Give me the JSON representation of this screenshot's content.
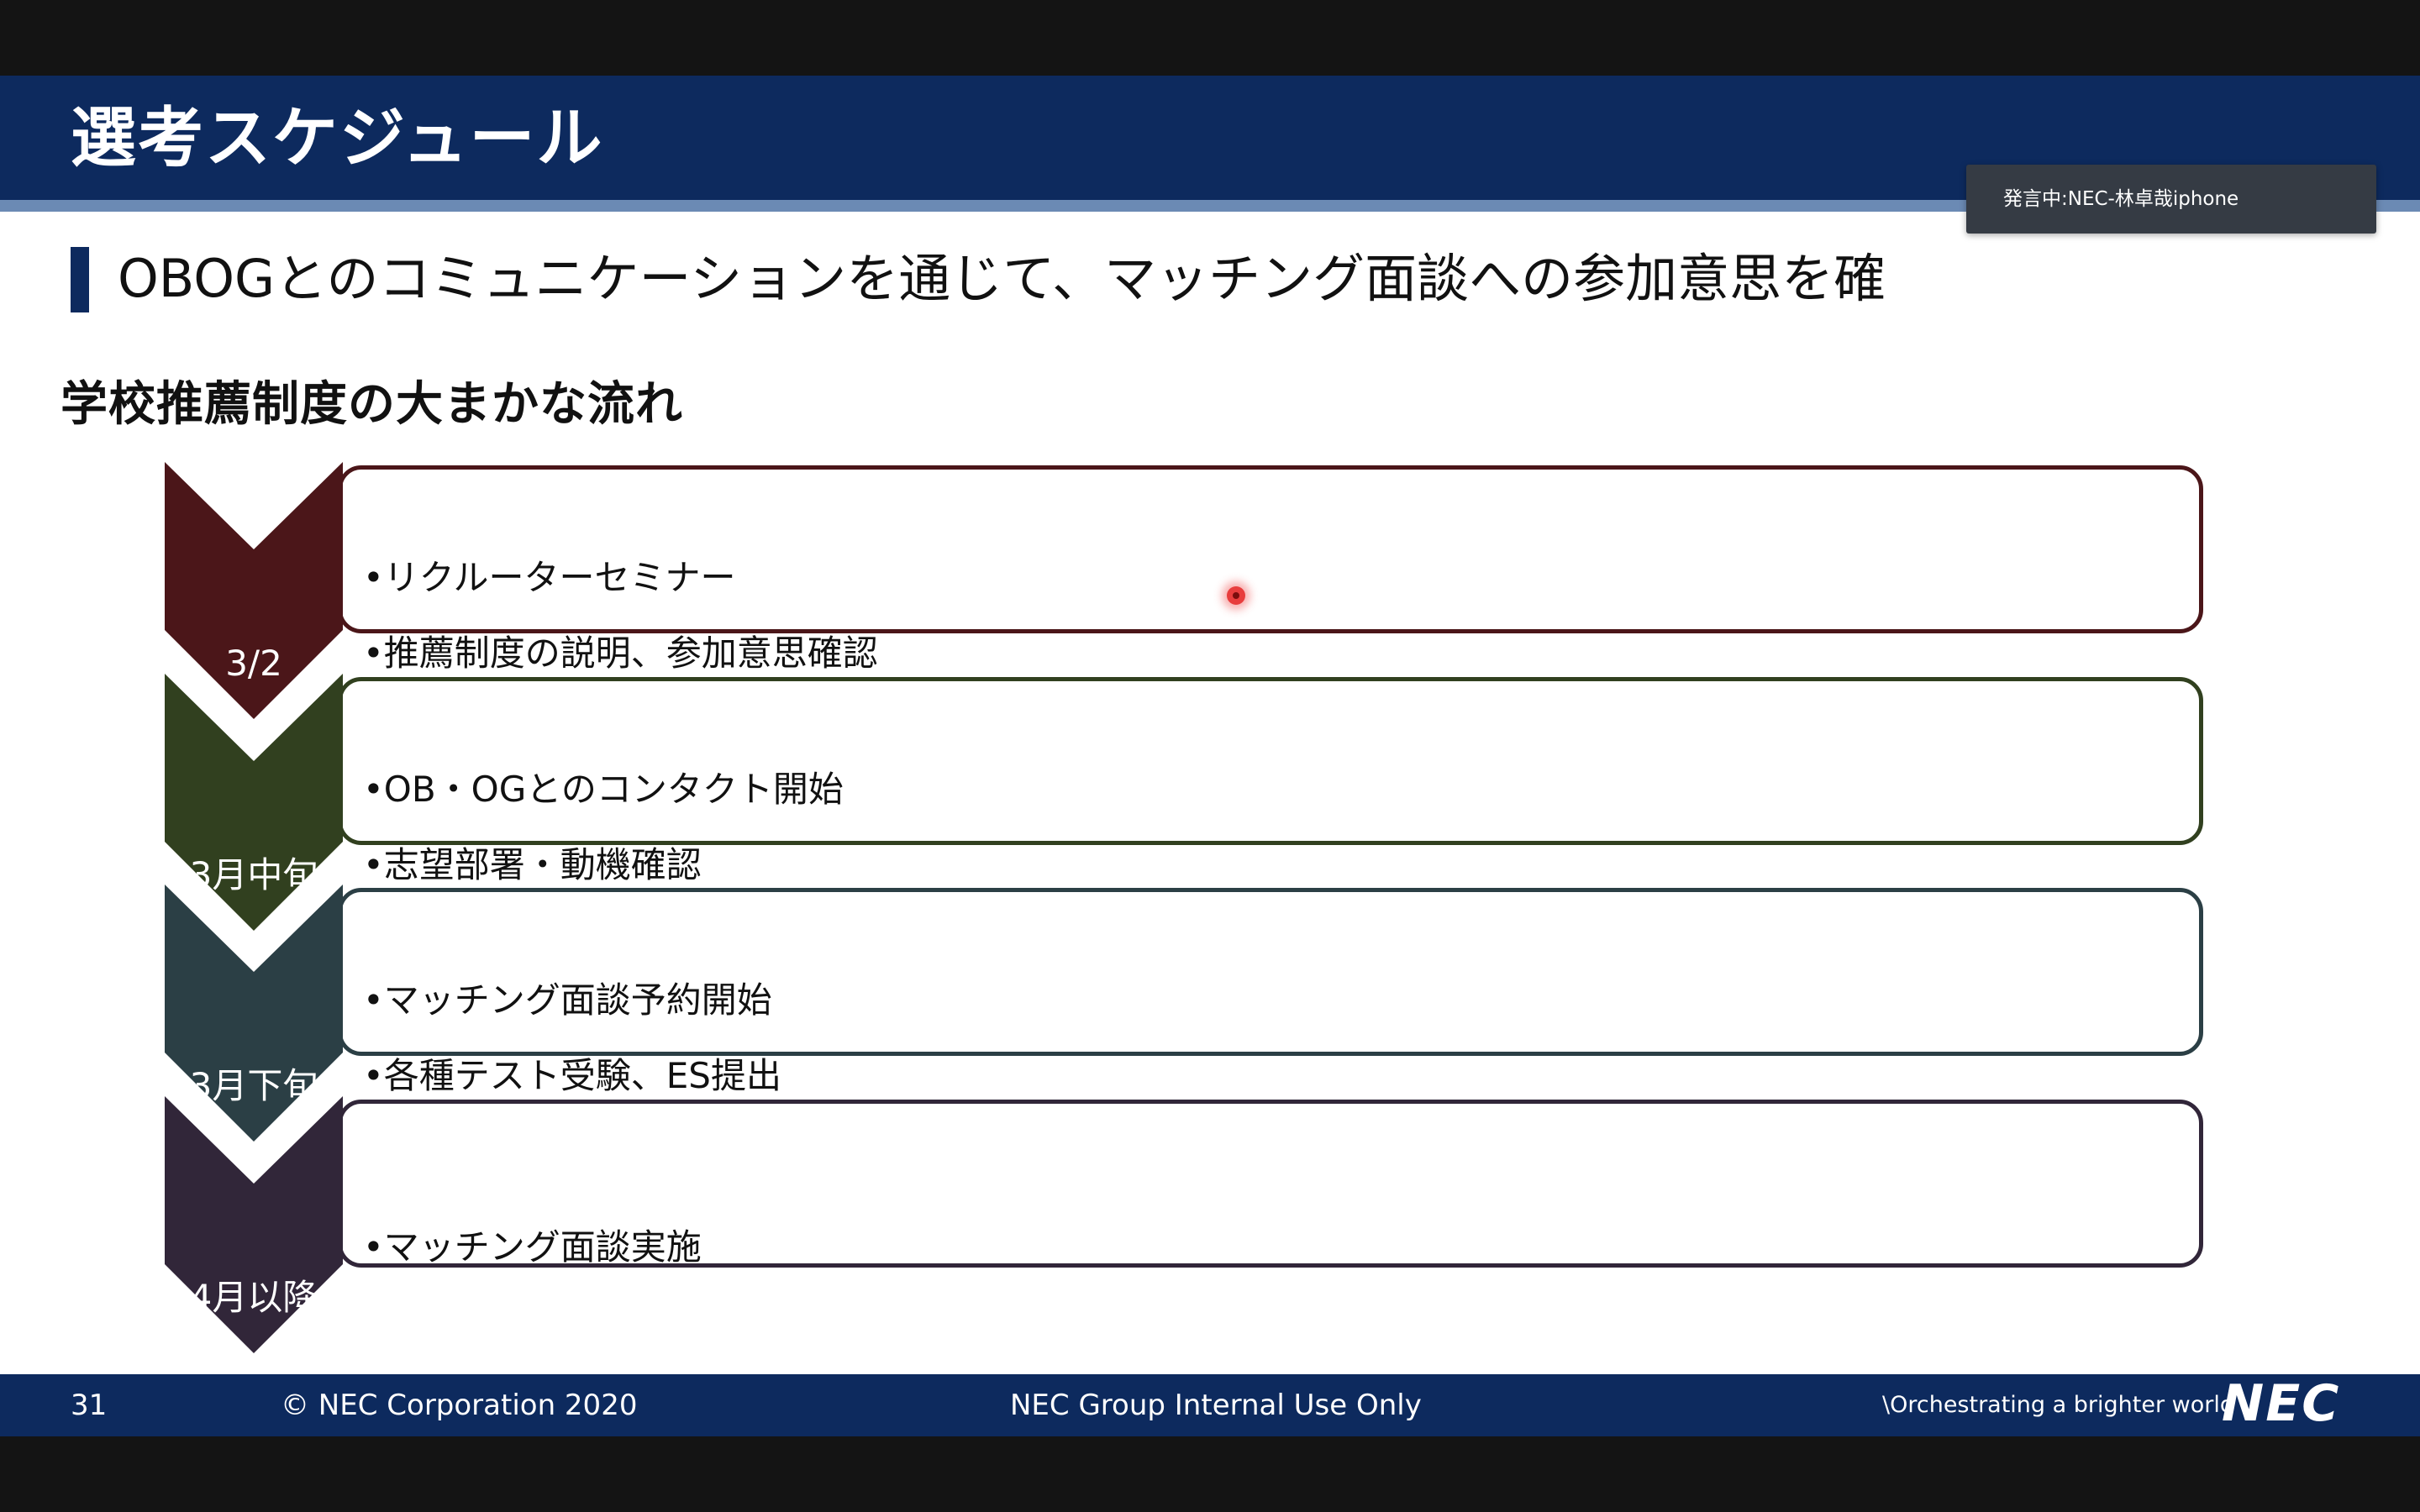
{
  "slide": {
    "title": "選考スケジュール",
    "lead": "OBOGとのコミュニケーションを通じて、マッチング面談への参加意思を確",
    "section_heading": "学校推薦制度の大まかな流れ",
    "steps": [
      {
        "date": "3/2",
        "color": "#4b1619",
        "bullets": [
          "•リクルーターセミナー",
          "•推薦制度の説明、参加意思確認"
        ]
      },
      {
        "date": "3月中旬",
        "color": "#31401f",
        "bullets": [
          "•OB・OGとのコンタクト開始",
          "•志望部署・動機確認"
        ]
      },
      {
        "date": "3月下旬",
        "color": "#2b3f45",
        "bullets": [
          "•マッチング面談予約開始",
          "•各種テスト受験、ES提出"
        ]
      },
      {
        "date": "4月以降",
        "color": "#312639",
        "bullets": [
          "•マッチング面談実施"
        ]
      }
    ]
  },
  "speaker_popup": {
    "text": "発言中:NEC-林卓哉iphone"
  },
  "footer": {
    "page_number": "31",
    "copyright": "© NEC Corporation 2020",
    "classification": "NEC Group Internal Use Only",
    "tagline": "\\Orchestrating a brighter world",
    "logo": "NEC"
  },
  "colors": {
    "title_bar": "#0d2a5e",
    "accent_stripe": "#6b8ab4",
    "popup_bg": "#353b44"
  }
}
